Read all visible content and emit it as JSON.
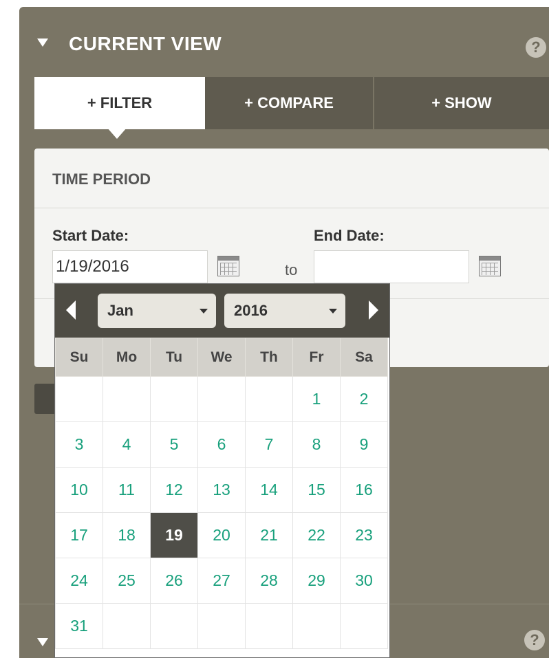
{
  "panel": {
    "title": "CURRENT VIEW",
    "help_label": "?"
  },
  "tabs": [
    {
      "label": "+ FILTER"
    },
    {
      "label": "+ COMPARE"
    },
    {
      "label": "+ SHOW"
    }
  ],
  "filter": {
    "heading": "TIME PERIOD",
    "start_label": "Start Date:",
    "start_value": "1/19/2016",
    "to_label": "to",
    "end_label": "End Date:",
    "end_value": ""
  },
  "datepicker": {
    "month": "Jan",
    "year": "2016",
    "weekdays": [
      "Su",
      "Mo",
      "Tu",
      "We",
      "Th",
      "Fr",
      "Sa"
    ],
    "weeks": [
      [
        "",
        "",
        "",
        "",
        "",
        "1",
        "2"
      ],
      [
        "3",
        "4",
        "5",
        "6",
        "7",
        "8",
        "9"
      ],
      [
        "10",
        "11",
        "12",
        "13",
        "14",
        "15",
        "16"
      ],
      [
        "17",
        "18",
        "19",
        "20",
        "21",
        "22",
        "23"
      ],
      [
        "24",
        "25",
        "26",
        "27",
        "28",
        "29",
        "30"
      ],
      [
        "31",
        "",
        "",
        "",
        "",
        "",
        ""
      ]
    ],
    "selected_day": "19",
    "accent_color": "#18a07c"
  }
}
